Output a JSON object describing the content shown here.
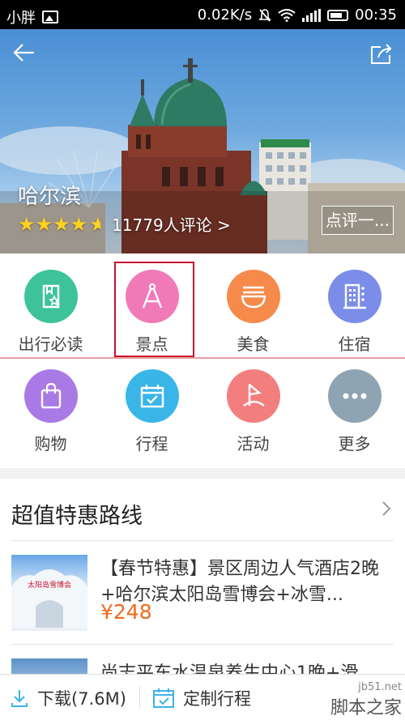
{
  "status_bar": {
    "carrier": "小胖",
    "speed": "0.02K/s",
    "time": "00:35"
  },
  "hero": {
    "city": "哈尔滨",
    "stars": "★★★★",
    "half_star": "★",
    "reviews": "11779人评论 >",
    "review_button": "点评一..."
  },
  "categories": [
    {
      "label": "出行必读",
      "color": "#3ec29a",
      "icon": "book-star-icon"
    },
    {
      "label": "景点",
      "color": "#f07ab8",
      "icon": "compass-icon"
    },
    {
      "label": "美食",
      "color": "#f58a4a",
      "icon": "noodle-bowl-icon"
    },
    {
      "label": "住宿",
      "color": "#7b8de8",
      "icon": "hotel-icon"
    },
    {
      "label": "购物",
      "color": "#a97ae6",
      "icon": "shopping-bag-icon"
    },
    {
      "label": "行程",
      "color": "#3ab5e8",
      "icon": "calendar-icon"
    },
    {
      "label": "活动",
      "color": "#f27e7e",
      "icon": "flag-icon"
    },
    {
      "label": "更多",
      "color": "#8fa4b2",
      "icon": "more-icon"
    }
  ],
  "routes": {
    "title": "超值特惠路线",
    "items": [
      {
        "text": "【春节特惠】景区周边人气酒店2晚+哈尔滨太阳岛雪博会+冰雪...",
        "price": "¥248",
        "thumb_text": "太阳岛雪博会"
      },
      {
        "text": "尚志平东水温泉养生中心1晚+滑"
      }
    ]
  },
  "bottom_bar": {
    "download": "下载(7.6M)",
    "custom": "定制行程"
  },
  "watermark": {
    "line1": "jb51.net",
    "line2": "脚本之家"
  }
}
